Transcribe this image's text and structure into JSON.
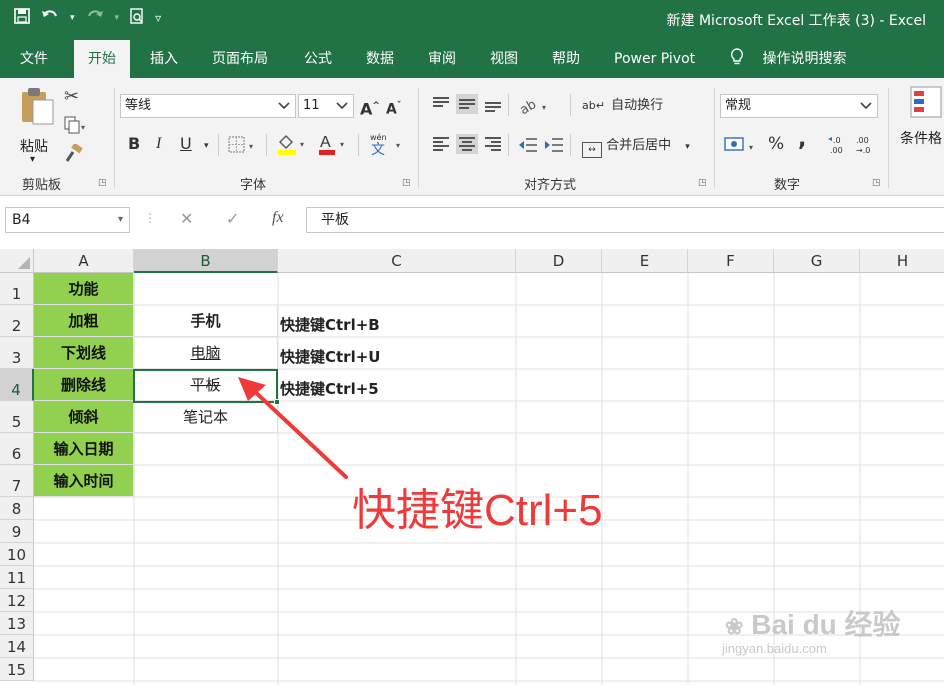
{
  "window": {
    "title": "新建 Microsoft Excel 工作表 (3)  -  Excel"
  },
  "menu": {
    "tabs": [
      "文件",
      "开始",
      "插入",
      "页面布局",
      "公式",
      "数据",
      "审阅",
      "视图",
      "帮助",
      "Power Pivot"
    ],
    "active_tab": "开始",
    "tell_me": "操作说明搜索"
  },
  "ribbon": {
    "clipboard": {
      "paste_label": "粘贴",
      "group_label": "剪贴板"
    },
    "font": {
      "font_name": "等线",
      "font_size": "11",
      "group_label": "字体",
      "bold": "B",
      "italic": "I",
      "underline": "U"
    },
    "alignment": {
      "wrap_text": "自动换行",
      "merge_center": "合并后居中",
      "group_label": "对齐方式"
    },
    "number": {
      "format": "常规",
      "percent": "%",
      "comma": ",",
      "group_label": "数字"
    },
    "styles": {
      "conditional_format": "条件格"
    }
  },
  "formula_bar": {
    "name_box": "B4",
    "fx": "fx",
    "value": "平板"
  },
  "grid": {
    "columns": [
      "A",
      "B",
      "C",
      "D",
      "E",
      "F",
      "G",
      "H"
    ],
    "selected_column": "B",
    "rows": [
      "1",
      "2",
      "3",
      "4",
      "5",
      "6",
      "7",
      "8",
      "9",
      "10",
      "11",
      "12",
      "13",
      "14",
      "15"
    ],
    "selected_row": "4",
    "col_a": [
      "功能",
      "加粗",
      "下划线",
      "删除线",
      "倾斜",
      "输入日期",
      "输入时间"
    ],
    "col_b": [
      "",
      "手机",
      "电脑",
      "平板",
      "笔记本"
    ],
    "col_c": [
      "",
      "快捷键Ctrl+B",
      "快捷键Ctrl+U",
      "快捷键Ctrl+5"
    ]
  },
  "annotation": {
    "text": "快捷键Ctrl+5"
  },
  "watermark": {
    "brand": "Bai du 经验",
    "url": "jingyan.baidu.com"
  },
  "colors": {
    "excel_green": "#217346",
    "highlight_green": "#92d050",
    "annotation_red": "#f03a3a"
  }
}
